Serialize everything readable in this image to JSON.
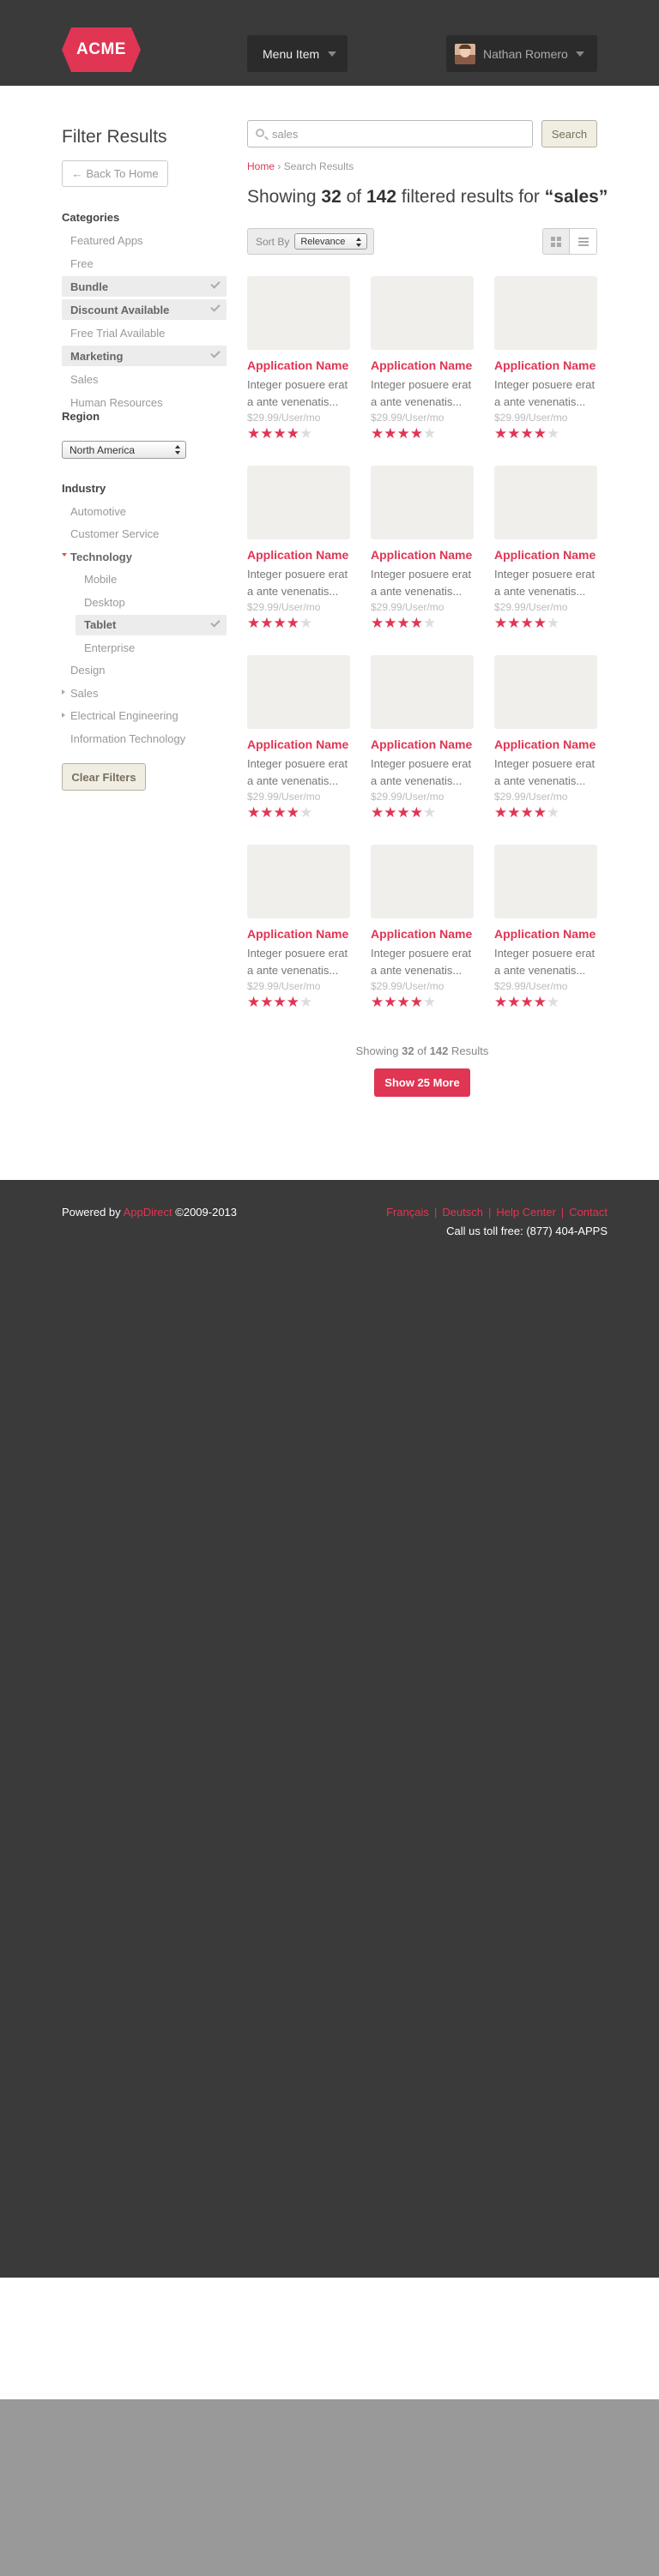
{
  "header": {
    "logo": "ACME",
    "menu_label": "Menu Item",
    "user_name": "Nathan Romero"
  },
  "sidebar": {
    "title": "Filter Results",
    "back_label": "Back To Home",
    "categories_label": "Categories",
    "categories": [
      {
        "label": "Featured Apps",
        "selected": false
      },
      {
        "label": "Free",
        "selected": false
      },
      {
        "label": "Bundle",
        "selected": true
      },
      {
        "label": "Discount Available",
        "selected": true
      },
      {
        "label": "Free Trial Available",
        "selected": false
      },
      {
        "label": "Marketing",
        "selected": true
      },
      {
        "label": "Sales",
        "selected": false
      },
      {
        "label": "Human Resources",
        "selected": false
      }
    ],
    "region_label": "Region",
    "region_value": "North America",
    "industry_label": "Industry",
    "industry": [
      {
        "label": "Automotive"
      },
      {
        "label": "Customer Service"
      },
      {
        "label": "Technology",
        "expanded": true
      },
      {
        "label": "Mobile",
        "sub": true
      },
      {
        "label": "Desktop",
        "sub": true
      },
      {
        "label": "Tablet",
        "sub": true,
        "selected": true
      },
      {
        "label": "Enterprise",
        "sub": true
      },
      {
        "label": "Design"
      },
      {
        "label": "Sales",
        "collapsed": true
      },
      {
        "label": "Electrical Engineering",
        "collapsed": true
      },
      {
        "label": "Information Technology"
      }
    ],
    "clear_label": "Clear Filters"
  },
  "search": {
    "value": "sales",
    "button_label": "Search"
  },
  "breadcrumb": {
    "home": "Home",
    "separator": "›",
    "current": "Search Results"
  },
  "results_heading": {
    "prefix": "Showing",
    "shown": "32",
    "of": "of",
    "total": "142",
    "middle": "filtered results for",
    "query": "“sales”"
  },
  "sort": {
    "label": "Sort By",
    "value": "Relevance"
  },
  "cards": [
    {
      "name": "Application Name",
      "desc": "Integer posuere erat a ante venenatis...",
      "price": "$29.99/User/mo",
      "rating": 4
    },
    {
      "name": "Application Name",
      "desc": "Integer posuere erat a ante venenatis...",
      "price": "$29.99/User/mo",
      "rating": 4
    },
    {
      "name": "Application Name",
      "desc": "Integer posuere erat a ante venenatis...",
      "price": "$29.99/User/mo",
      "rating": 4
    },
    {
      "name": "Application Name",
      "desc": "Integer posuere erat a ante venenatis...",
      "price": "$29.99/User/mo",
      "rating": 4
    },
    {
      "name": "Application Name",
      "desc": "Integer posuere erat a ante venenatis...",
      "price": "$29.99/User/mo",
      "rating": 4
    },
    {
      "name": "Application Name",
      "desc": "Integer posuere erat a ante venenatis...",
      "price": "$29.99/User/mo",
      "rating": 4
    },
    {
      "name": "Application Name",
      "desc": "Integer posuere erat a ante venenatis...",
      "price": "$29.99/User/mo",
      "rating": 4
    },
    {
      "name": "Application Name",
      "desc": "Integer posuere erat a ante venenatis...",
      "price": "$29.99/User/mo",
      "rating": 4
    },
    {
      "name": "Application Name",
      "desc": "Integer posuere erat a ante venenatis...",
      "price": "$29.99/User/mo",
      "rating": 4
    },
    {
      "name": "Application Name",
      "desc": "Integer posuere erat a ante venenatis...",
      "price": "$29.99/User/mo",
      "rating": 4
    },
    {
      "name": "Application Name",
      "desc": "Integer posuere erat a ante venenatis...",
      "price": "$29.99/User/mo",
      "rating": 4
    },
    {
      "name": "Application Name",
      "desc": "Integer posuere erat a ante venenatis...",
      "price": "$29.99/User/mo",
      "rating": 4
    }
  ],
  "results_footer": {
    "prefix": "Showing",
    "shown": "32",
    "of": "of",
    "total": "142",
    "suffix": "Results",
    "more_label": "Show 25 More"
  },
  "footer": {
    "powered_prefix": "Powered by",
    "powered_brand": "AppDirect",
    "copyright": "©2009-2013",
    "links": [
      "Français",
      "Deutsch",
      "Help Center",
      "Contact"
    ],
    "separator": "|",
    "tollfree": "Call us toll free: (877) 404-APPS"
  },
  "colors": {
    "accent": "#e03553",
    "header_bg": "#3a3a3a",
    "star_off": "#dddddd"
  }
}
